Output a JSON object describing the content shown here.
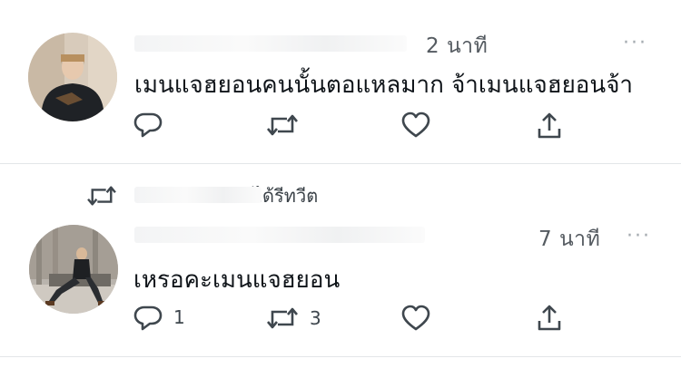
{
  "tweets": [
    {
      "time": "2 นาที",
      "more": "···",
      "text": "เมนแจฮยอนคนนั้นตอแหลมาก จ้าเมนแจฮยอนจ้า",
      "actions": {
        "reply_count": "",
        "retweet_count": "",
        "like_count": ""
      }
    },
    {
      "retweet_label": "ได้รีทวีต",
      "time": "7 นาที",
      "more": "···",
      "text": "เหรอคะเมนแจฮยอน",
      "actions": {
        "reply_count": "1",
        "retweet_count": "3",
        "like_count": ""
      }
    }
  ],
  "icons": [
    "reply-icon",
    "retweet-icon",
    "like-icon",
    "share-icon",
    "more-icon"
  ]
}
